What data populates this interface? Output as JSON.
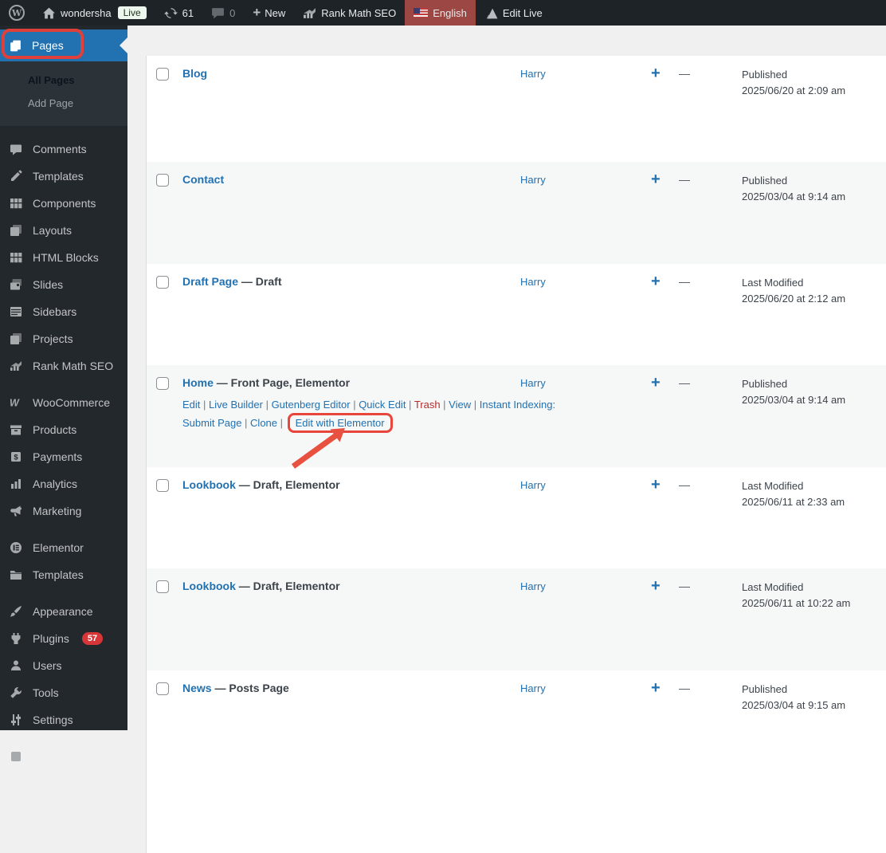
{
  "admin_bar": {
    "site_name": "wondersha",
    "live_badge": "Live",
    "update_count": "61",
    "comment_count": "0",
    "new_label": "New",
    "rank_math_label": "Rank Math SEO",
    "language_label": "English",
    "edit_live_label": "Edit Live"
  },
  "sidebar": {
    "pages_label": "Pages",
    "submenu": [
      {
        "label": "All Pages",
        "current": true
      },
      {
        "label": "Add Page",
        "current": false
      }
    ],
    "groups": [
      {
        "items": [
          {
            "label": "Comments",
            "icon": "comments-icon"
          },
          {
            "label": "Templates",
            "icon": "pencil-icon"
          },
          {
            "label": "Components",
            "icon": "grid-icon"
          },
          {
            "label": "Layouts",
            "icon": "layers-icon"
          },
          {
            "label": "HTML Blocks",
            "icon": "grid-icon"
          },
          {
            "label": "Slides",
            "icon": "photos-icon"
          },
          {
            "label": "Sidebars",
            "icon": "table-icon"
          },
          {
            "label": "Projects",
            "icon": "layers-icon"
          },
          {
            "label": "Rank Math SEO",
            "icon": "chart-icon"
          }
        ]
      },
      {
        "items": [
          {
            "label": "WooCommerce",
            "icon": "woocommerce-icon"
          },
          {
            "label": "Products",
            "icon": "box-icon"
          },
          {
            "label": "Payments",
            "icon": "dollar-icon"
          },
          {
            "label": "Analytics",
            "icon": "bars-icon"
          },
          {
            "label": "Marketing",
            "icon": "megaphone-icon"
          }
        ]
      },
      {
        "items": [
          {
            "label": "Elementor",
            "icon": "elementor-icon"
          },
          {
            "label": "Templates",
            "icon": "folder-icon"
          }
        ]
      },
      {
        "items": [
          {
            "label": "Appearance",
            "icon": "brush-icon"
          },
          {
            "label": "Plugins",
            "icon": "plug-icon",
            "badge": "57"
          },
          {
            "label": "Users",
            "icon": "user-icon"
          },
          {
            "label": "Tools",
            "icon": "wrench-icon"
          },
          {
            "label": "Settings",
            "icon": "sliders-icon"
          }
        ]
      },
      {
        "items": [
          {
            "label": "",
            "icon": "generic-icon"
          }
        ]
      }
    ]
  },
  "table": {
    "rows": [
      {
        "title": "Blog",
        "suffix": "",
        "author": "Harry",
        "status": "Published",
        "date": "2025/06/20 at 2:09 am"
      },
      {
        "title": "Contact",
        "suffix": "",
        "author": "Harry",
        "status": "Published",
        "date": "2025/03/04 at 9:14 am"
      },
      {
        "title": "Draft Page",
        "suffix": " — Draft",
        "author": "Harry",
        "status": "Last Modified",
        "date": "2025/06/20 at 2:12 am"
      },
      {
        "title": "Home",
        "suffix": " — Front Page, Elementor",
        "author": "Harry",
        "status": "Published",
        "date": "2025/03/04 at 9:14 am",
        "actions": [
          {
            "label": "Edit"
          },
          {
            "label": "Live Builder"
          },
          {
            "label": "Gutenberg Editor"
          },
          {
            "label": "Quick Edit"
          },
          {
            "label": "Trash",
            "color": "red"
          },
          {
            "label": "View"
          },
          {
            "label": "Instant Indexing: Submit Page"
          },
          {
            "label": "Clone"
          },
          {
            "label": "Edit with Elementor",
            "boxed": true
          }
        ]
      },
      {
        "title": "Lookbook",
        "suffix": " — Draft, Elementor",
        "author": "Harry",
        "status": "Last Modified",
        "date": "2025/06/11 at 2:33 am"
      },
      {
        "title": "Lookbook",
        "suffix": " — Draft, Elementor",
        "author": "Harry",
        "status": "Last Modified",
        "date": "2025/06/11 at 10:22 am"
      },
      {
        "title": "News",
        "suffix": " — Posts Page",
        "author": "Harry",
        "status": "Published",
        "date": "2025/03/04 at 9:15 am"
      }
    ],
    "plus_glyph": "+",
    "dash_glyph": "—"
  },
  "colors": {
    "accent": "#2271b1",
    "annotation_red": "#e8453c",
    "trash_red": "#b32d2e",
    "badge_red": "#d63638",
    "language_bg": "#9c4744"
  }
}
